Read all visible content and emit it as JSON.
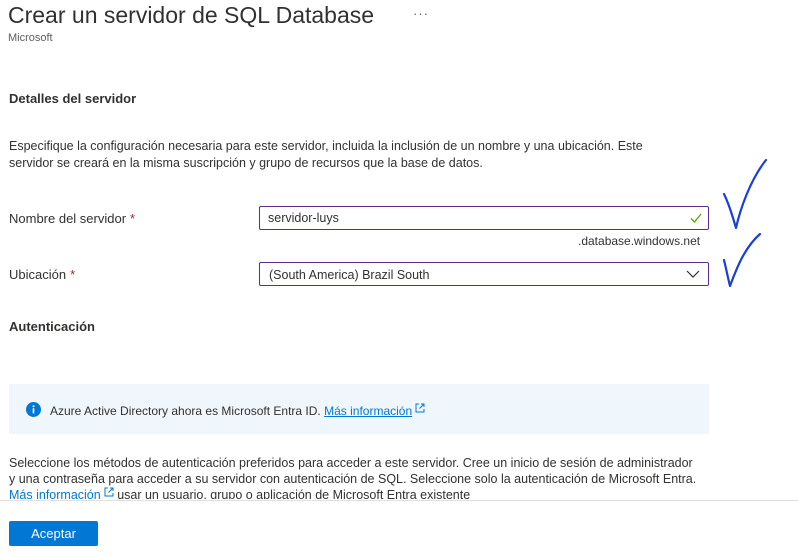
{
  "header": {
    "title": "Crear un servidor de SQL Database",
    "more_label": "···",
    "subtitle": "Microsoft"
  },
  "server_details": {
    "heading": "Detalles del servidor",
    "description": "Especifique la configuración necesaria para este servidor, incluida la inclusión de un nombre y una ubicación. Este servidor se creará en la misma suscripción y grupo de recursos que la base de datos.",
    "server_name": {
      "label": "Nombre del servidor",
      "required_mark": "*",
      "value": "servidor-luys",
      "suffix": ".database.windows.net"
    },
    "location": {
      "label": "Ubicación",
      "required_mark": "*",
      "selected": "(South America) Brazil South"
    }
  },
  "authentication": {
    "heading": "Autenticación",
    "info_text": "Azure Active Directory ahora es Microsoft Entra ID.",
    "info_link": "Más información",
    "description_part1": "Seleccione los métodos de autenticación preferidos para acceder a este servidor. Cree un inicio de sesión de administrador y una contraseña para acceder a su servidor con autenticación de SQL. Seleccione solo la autenticación de Microsoft Entra.",
    "description_link": "Más información",
    "description_part2": "usar un usuario, grupo o aplicación de Microsoft Entra existente"
  },
  "footer": {
    "accept_label": "Aceptar"
  },
  "colors": {
    "accent": "#0078d4",
    "field_border": "#5c2d91",
    "required": "#a4262c",
    "valid_check": "#57a300",
    "annotation_ink": "#1a3fd6",
    "info_bg": "#eff6fc"
  },
  "icons": {
    "valid": "checkmark-icon",
    "dropdown": "chevron-down-icon",
    "info": "info-icon",
    "external": "external-link-icon"
  }
}
